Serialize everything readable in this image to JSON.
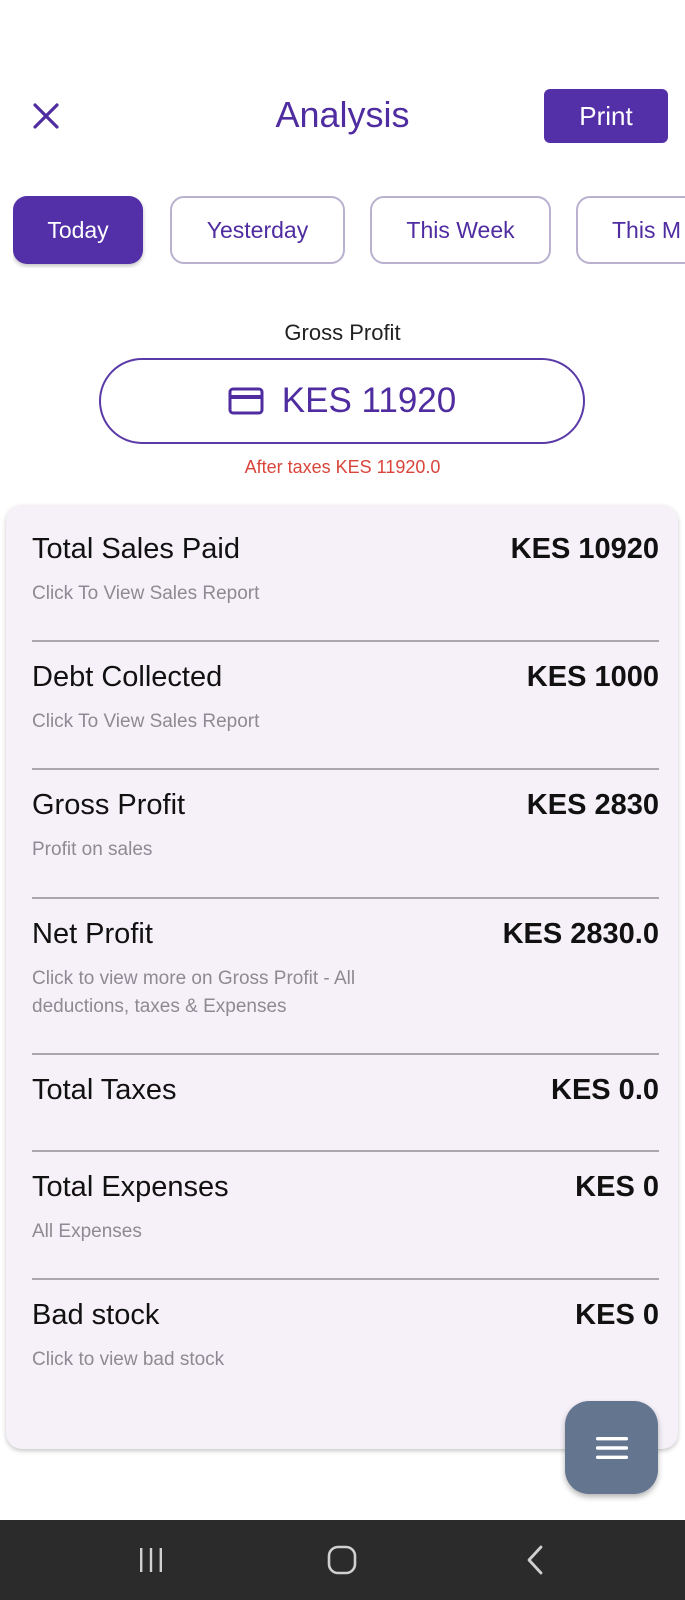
{
  "header": {
    "title": "Analysis",
    "print_label": "Print",
    "close_icon": "close-icon"
  },
  "filters": [
    {
      "label": "Today",
      "active": true
    },
    {
      "label": "Yesterday",
      "active": false
    },
    {
      "label": "This Week",
      "active": false
    },
    {
      "label": "This M",
      "active": false
    }
  ],
  "gross_profit": {
    "label": "Gross Profit",
    "value": "KES 11920",
    "icon": "credit-card-icon",
    "after_taxes": "After taxes KES 11920.0"
  },
  "summary": [
    {
      "title": "Total Sales Paid",
      "value": "KES 10920",
      "subtitle": "Click To View Sales Report"
    },
    {
      "title": "Debt Collected",
      "value": "KES 1000",
      "subtitle": "Click To View Sales Report"
    },
    {
      "title": "Gross Profit",
      "value": "KES 2830",
      "subtitle": "Profit on sales"
    },
    {
      "title": "Net Profit",
      "value": "KES 2830.0",
      "subtitle": "Click to view more on Gross Profit -  All deductions, taxes & Expenses"
    },
    {
      "title": "Total Taxes",
      "value": "KES 0.0",
      "subtitle": ""
    },
    {
      "title": "Total Expenses",
      "value": "KES 0",
      "subtitle": "All Expenses"
    },
    {
      "title": "Bad stock",
      "value": "KES 0",
      "subtitle": "Click to view bad stock"
    }
  ],
  "fab": {
    "icon": "menu-icon"
  },
  "navbar": {
    "icons": [
      "recent-apps-icon",
      "home-icon",
      "back-icon"
    ]
  },
  "colors": {
    "primary": "#5330a8",
    "title": "#4f2ca0",
    "error": "#d9453b",
    "card_bg": "#f6f1f9",
    "fab_bg": "#647590",
    "navbar_bg": "#2b2b2b"
  }
}
